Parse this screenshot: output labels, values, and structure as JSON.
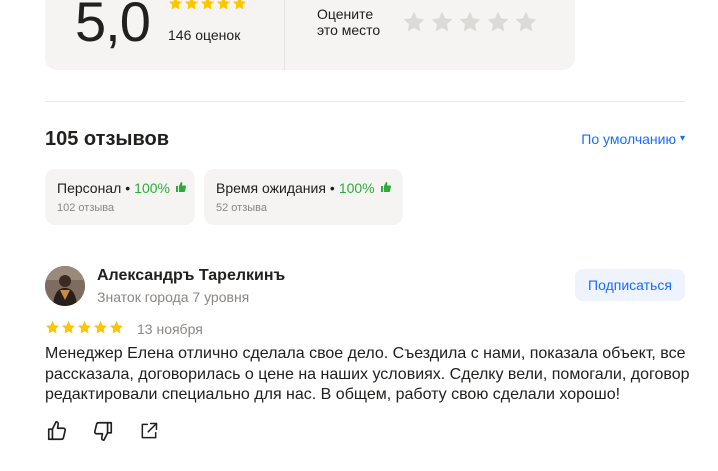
{
  "rating": {
    "score": "5,0",
    "stars_filled": 5,
    "count_text": "146 оценок",
    "rate_label_line1": "Оцените",
    "rate_label_line2": "это место",
    "rate_stars_total": 5
  },
  "reviews_header": {
    "title": "105 отзывов",
    "sort_label": "По умолчанию",
    "sort_caret": "▾"
  },
  "aspects": [
    {
      "name": "Персонал",
      "separator": "•",
      "percent": "100%",
      "count": "102 отзыва"
    },
    {
      "name": "Время ожидания",
      "separator": "•",
      "percent": "100%",
      "count": "52 отзыва"
    }
  ],
  "review": {
    "author": "Александръ Тарелкинъ",
    "level": "Знаток города 7 уровня",
    "subscribe_label": "Подписаться",
    "stars": 5,
    "date": "13 ноября",
    "text": "Менеджер Елена отлично сделала свое дело. Съездила с нами, показала объект, все рассказала, договорилась о цене на наших условиях. Сделку вели, помогали, договор редактировали специально для нас. В общем, работу свою сделали хорошо!"
  },
  "icons": {
    "like": "thumbs-up-icon",
    "dislike": "thumbs-down-icon",
    "share": "share-icon"
  },
  "colors": {
    "star_gold": "#fcc600",
    "star_gray": "#dcdad7",
    "accent_blue": "#196dff",
    "positive_green": "#2eac3a",
    "card_bg": "#f5f4f2"
  }
}
